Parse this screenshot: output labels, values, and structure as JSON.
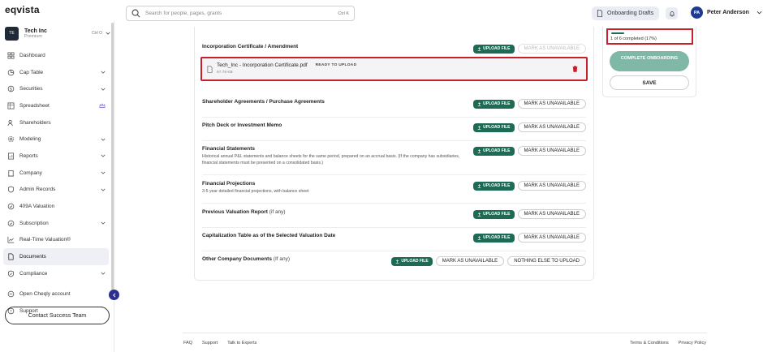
{
  "app": {
    "logo": "eqvista"
  },
  "search": {
    "placeholder": "Search for people, pages, grants",
    "shortcut": "Ctrl K"
  },
  "header": {
    "drafts_label": "Onboarding Drafts",
    "user_initials": "PA",
    "user_name": "Peter Anderson"
  },
  "company": {
    "badge": "TE",
    "name": "Tech Inc",
    "plan": "Premium",
    "shortcut": "Ctrl O"
  },
  "sidebar": {
    "items": [
      {
        "label": "Dashboard"
      },
      {
        "label": "Cap Table"
      },
      {
        "label": "Securities"
      },
      {
        "label": "Spreadsheet"
      },
      {
        "label": "Shareholders"
      },
      {
        "label": "Modeling"
      },
      {
        "label": "Reports"
      },
      {
        "label": "Company"
      },
      {
        "label": "Admin Records"
      },
      {
        "label": "409A Valuation"
      },
      {
        "label": "Subscription"
      },
      {
        "label": "Real-Time Valuation®"
      },
      {
        "label": "Documents"
      },
      {
        "label": "Compliance"
      },
      {
        "label": "Open Cheqly account"
      },
      {
        "label": "Support"
      }
    ],
    "contact_label": "Contact Success Team"
  },
  "documents": {
    "upload_label": "UPLOAD FILE",
    "unavailable_label": "MARK AS UNAVAILABLE",
    "nothing_else_label": "NOTHING ELSE TO UPLOAD",
    "rows": [
      {
        "title": "Incorporation Certificate / Amendment"
      },
      {
        "title": "Shareholder Agreements / Purchase Agreements"
      },
      {
        "title": "Pitch Deck or Investment Memo"
      },
      {
        "title": "Financial Statements",
        "desc": "Historical annual P&L statements and balance sheets for the same period, prepared on an accrual basis. (If the company has subsidiaries, financial statements must be presented on a consolidated basis.)"
      },
      {
        "title": "Financial Projections",
        "desc": "3-5 year detailed financial projections, with balance sheet"
      },
      {
        "title": "Previous Valuation Report",
        "optional": "(if any)"
      },
      {
        "title": "Capitalization Table as of the Selected Valuation Date"
      },
      {
        "title": "Other Company Documents",
        "optional": "(If any)"
      }
    ],
    "file": {
      "name": "Tech_Inc - Incorporation Certificate.pdf",
      "size": "57.78 KB",
      "status": "READY TO UPLOAD"
    }
  },
  "progress": {
    "text": "1 of 6 completed (17%)",
    "fraction": 0.17
  },
  "actions": {
    "complete_label": "COMPLETE ONBOARDING",
    "save_label": "SAVE"
  },
  "footer": {
    "left": [
      "FAQ",
      "Support",
      "Talk to Experts"
    ],
    "right": [
      "Terms & Conditions",
      "Privacy Policy"
    ]
  },
  "colors": {
    "primary": "#1d6b55",
    "highlight": "#c8202a",
    "accent_dark": "#2b2f8f"
  }
}
